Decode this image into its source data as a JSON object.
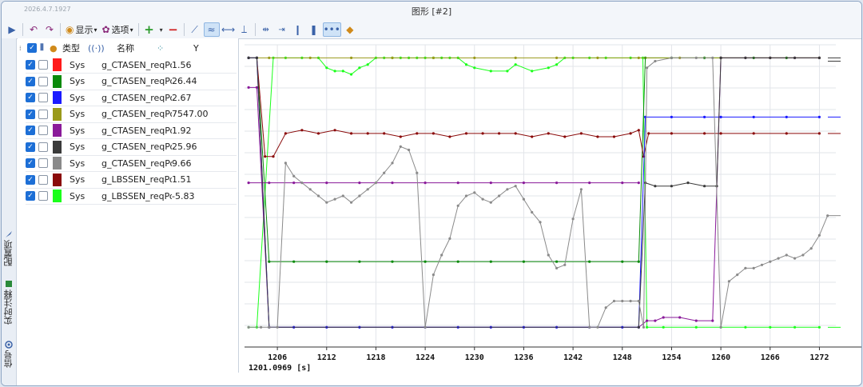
{
  "window": {
    "version_text": "2026.4.7.1927",
    "title": "图形 [#2]"
  },
  "toolbar": {
    "display_label": "显示",
    "options_label": "选项"
  },
  "side_tabs": [
    {
      "label": "配置项",
      "icon": "settings-icon"
    },
    {
      "label": "实时注释",
      "icon": "annotation-icon"
    },
    {
      "label": "信号",
      "icon": "signal-icon"
    }
  ],
  "table": {
    "headers": {
      "type": "类型",
      "name": "名称",
      "y": "Y"
    },
    "rows": [
      {
        "color": "#ff1a1a",
        "type": "Sys",
        "name": "g_CTASEN_reqPorts_",
        "value": "1.56"
      },
      {
        "color": "#0a8a0a",
        "type": "Sys",
        "name": "g_CTASEN_reqPorts_",
        "value": "26.44"
      },
      {
        "color": "#1a1aff",
        "type": "Sys",
        "name": "g_CTASEN_reqPorts_",
        "value": "2.67"
      },
      {
        "color": "#9a9a1a",
        "type": "Sys",
        "name": "g_CTASEN_reqPorts_",
        "value": "7547.00"
      },
      {
        "color": "#8a1a9a",
        "type": "Sys",
        "name": "g_CTASEN_reqPorts_",
        "value": "1.92"
      },
      {
        "color": "#3a3a3a",
        "type": "Sys",
        "name": "g_CTASEN_reqPorts_",
        "value": "25.96"
      },
      {
        "color": "#8a8a8a",
        "type": "Sys",
        "name": "g_CTASEN_reqPorts_",
        "value": "9.66"
      },
      {
        "color": "#8a0a0a",
        "type": "Sys",
        "name": "g_LBSSEN_reqPorts_",
        "value": "1.51"
      },
      {
        "color": "#1aff1a",
        "type": "Sys",
        "name": "g_LBSSEN_reqPorts_",
        "value": "-5.83"
      }
    ]
  },
  "chart_data": {
    "type": "line",
    "x_cursor_label": "1201.0969 [s]",
    "xlim": [
      1202,
      1274
    ],
    "x_ticks": [
      "1206",
      "1212",
      "1218",
      "1224",
      "1230",
      "1236",
      "1242",
      "1248",
      "1254",
      "1260",
      "1266",
      "1272"
    ],
    "grid": true,
    "series": [
      {
        "color": "#1aff1a",
        "points": [
          [
            1202.5,
            0.06
          ],
          [
            1203.5,
            0.06
          ],
          [
            1205.5,
            0.88
          ],
          [
            1207,
            0.88
          ],
          [
            1209,
            0.88
          ],
          [
            1211,
            0.88
          ],
          [
            1212,
            0.85
          ],
          [
            1213,
            0.84
          ],
          [
            1214,
            0.84
          ],
          [
            1215,
            0.83
          ],
          [
            1216,
            0.85
          ],
          [
            1217,
            0.86
          ],
          [
            1218,
            0.88
          ],
          [
            1219,
            0.88
          ],
          [
            1220,
            0.88
          ],
          [
            1221,
            0.88
          ],
          [
            1222,
            0.88
          ],
          [
            1223,
            0.88
          ],
          [
            1224,
            0.88
          ],
          [
            1225,
            0.88
          ],
          [
            1226,
            0.88
          ],
          [
            1227,
            0.88
          ],
          [
            1228,
            0.88
          ],
          [
            1229,
            0.86
          ],
          [
            1230,
            0.85
          ],
          [
            1232,
            0.84
          ],
          [
            1234,
            0.84
          ],
          [
            1235,
            0.86
          ],
          [
            1237,
            0.84
          ],
          [
            1239,
            0.85
          ],
          [
            1240,
            0.86
          ],
          [
            1241,
            0.88
          ],
          [
            1242,
            0.88
          ],
          [
            1244,
            0.88
          ],
          [
            1246,
            0.88
          ],
          [
            1249,
            0.88
          ],
          [
            1250.5,
            0.88
          ],
          [
            1251,
            0.06
          ],
          [
            1253,
            0.06
          ],
          [
            1257,
            0.06
          ],
          [
            1260,
            0.06
          ],
          [
            1263,
            0.06
          ],
          [
            1266,
            0.06
          ],
          [
            1269,
            0.06
          ],
          [
            1272,
            0.06
          ]
        ]
      },
      {
        "color": "#0a8a0a",
        "points": [
          [
            1202.5,
            0.88
          ],
          [
            1203.5,
            0.88
          ],
          [
            1205,
            0.26
          ],
          [
            1208,
            0.26
          ],
          [
            1212,
            0.26
          ],
          [
            1216,
            0.26
          ],
          [
            1220,
            0.26
          ],
          [
            1224,
            0.26
          ],
          [
            1228,
            0.26
          ],
          [
            1232,
            0.26
          ],
          [
            1236,
            0.26
          ],
          [
            1240,
            0.26
          ],
          [
            1244,
            0.26
          ],
          [
            1248,
            0.26
          ],
          [
            1250,
            0.26
          ],
          [
            1250.8,
            0.88
          ],
          [
            1254,
            0.88
          ],
          [
            1258,
            0.88
          ],
          [
            1260,
            0.88
          ],
          [
            1264,
            0.88
          ],
          [
            1268,
            0.88
          ],
          [
            1272,
            0.88
          ]
        ]
      },
      {
        "color": "#9a9a1a",
        "points": [
          [
            1202.5,
            0.88
          ],
          [
            1203.5,
            0.88
          ],
          [
            1205,
            0.88
          ],
          [
            1210,
            0.88
          ],
          [
            1215,
            0.88
          ],
          [
            1220,
            0.88
          ],
          [
            1225,
            0.88
          ],
          [
            1230,
            0.88
          ],
          [
            1235,
            0.88
          ],
          [
            1240,
            0.88
          ],
          [
            1245,
            0.88
          ],
          [
            1250,
            0.88
          ],
          [
            1255,
            0.88
          ],
          [
            1260,
            0.88
          ],
          [
            1266,
            0.88
          ],
          [
            1272,
            0.88
          ]
        ]
      },
      {
        "color": "#8a0a0a",
        "points": [
          [
            1202.5,
            0.88
          ],
          [
            1203.5,
            0.88
          ],
          [
            1204.5,
            0.58
          ],
          [
            1205.5,
            0.58
          ],
          [
            1207,
            0.65
          ],
          [
            1209,
            0.66
          ],
          [
            1211,
            0.65
          ],
          [
            1213,
            0.66
          ],
          [
            1215,
            0.65
          ],
          [
            1217,
            0.65
          ],
          [
            1219,
            0.65
          ],
          [
            1221,
            0.64
          ],
          [
            1223,
            0.65
          ],
          [
            1225,
            0.65
          ],
          [
            1227,
            0.64
          ],
          [
            1229,
            0.65
          ],
          [
            1231,
            0.65
          ],
          [
            1233,
            0.65
          ],
          [
            1235,
            0.65
          ],
          [
            1237,
            0.64
          ],
          [
            1239,
            0.65
          ],
          [
            1241,
            0.64
          ],
          [
            1243,
            0.65
          ],
          [
            1245,
            0.64
          ],
          [
            1247,
            0.64
          ],
          [
            1249,
            0.65
          ],
          [
            1250,
            0.66
          ],
          [
            1250.6,
            0.58
          ],
          [
            1251.2,
            0.65
          ],
          [
            1254,
            0.65
          ],
          [
            1258,
            0.65
          ],
          [
            1260,
            0.65
          ],
          [
            1264,
            0.65
          ],
          [
            1268,
            0.65
          ],
          [
            1272,
            0.65
          ]
        ]
      },
      {
        "color": "#8a1a9a",
        "points": [
          [
            1202.5,
            0.79
          ],
          [
            1203.5,
            0.79
          ],
          [
            1205,
            0.06
          ],
          [
            1208,
            0.06
          ],
          [
            1212,
            0.06
          ],
          [
            1216,
            0.06
          ],
          [
            1220,
            0.06
          ],
          [
            1224,
            0.06
          ],
          [
            1228,
            0.06
          ],
          [
            1232,
            0.06
          ],
          [
            1236,
            0.06
          ],
          [
            1240,
            0.06
          ],
          [
            1244,
            0.06
          ],
          [
            1248,
            0.06
          ],
          [
            1250,
            0.06
          ],
          [
            1251,
            0.08
          ],
          [
            1252,
            0.08
          ],
          [
            1253,
            0.09
          ],
          [
            1255,
            0.09
          ],
          [
            1257,
            0.08
          ],
          [
            1259,
            0.08
          ],
          [
            1260,
            0.88
          ],
          [
            1263,
            0.88
          ],
          [
            1266,
            0.88
          ],
          [
            1269,
            0.88
          ],
          [
            1272,
            0.88
          ]
        ]
      },
      {
        "color": "#8a1a9a",
        "points": [
          [
            1202.5,
            0.5
          ],
          [
            1205,
            0.5
          ],
          [
            1208,
            0.5
          ],
          [
            1212,
            0.5
          ],
          [
            1216,
            0.5
          ],
          [
            1220,
            0.5
          ],
          [
            1224,
            0.5
          ],
          [
            1228,
            0.5
          ],
          [
            1232,
            0.5
          ],
          [
            1236,
            0.5
          ],
          [
            1240,
            0.5
          ],
          [
            1244,
            0.5
          ],
          [
            1248,
            0.5
          ],
          [
            1250,
            0.5
          ]
        ]
      },
      {
        "color": "#1a1aff",
        "points": [
          [
            1202.5,
            0.88
          ],
          [
            1203.5,
            0.88
          ],
          [
            1205,
            0.06
          ],
          [
            1208,
            0.06
          ],
          [
            1212,
            0.06
          ],
          [
            1216,
            0.06
          ],
          [
            1220,
            0.06
          ],
          [
            1224,
            0.06
          ],
          [
            1228,
            0.06
          ],
          [
            1232,
            0.06
          ],
          [
            1236,
            0.06
          ],
          [
            1240,
            0.06
          ],
          [
            1244,
            0.06
          ],
          [
            1248,
            0.06
          ],
          [
            1250,
            0.06
          ],
          [
            1250.8,
            0.7
          ],
          [
            1254,
            0.7
          ],
          [
            1258,
            0.7
          ],
          [
            1260,
            0.7
          ],
          [
            1264,
            0.7
          ],
          [
            1268,
            0.7
          ],
          [
            1272,
            0.7
          ]
        ]
      },
      {
        "color": "#3a3a3a",
        "points": [
          [
            1202.5,
            0.88
          ],
          [
            1203.5,
            0.88
          ],
          [
            1205,
            0.06
          ],
          [
            1250,
            0.06
          ],
          [
            1250.8,
            0.5
          ],
          [
            1252,
            0.49
          ],
          [
            1254,
            0.49
          ],
          [
            1256,
            0.5
          ],
          [
            1258,
            0.49
          ],
          [
            1259.5,
            0.49
          ],
          [
            1260,
            0.88
          ],
          [
            1263,
            0.88
          ],
          [
            1266,
            0.88
          ],
          [
            1269,
            0.88
          ],
          [
            1272,
            0.88
          ]
        ]
      },
      {
        "color": "#8a8a8a",
        "points": [
          [
            1202.5,
            0.06
          ],
          [
            1204,
            0.06
          ],
          [
            1205,
            0.06
          ],
          [
            1206,
            0.06
          ],
          [
            1207,
            0.56
          ],
          [
            1208,
            0.52
          ],
          [
            1209,
            0.5
          ],
          [
            1210,
            0.48
          ],
          [
            1211,
            0.46
          ],
          [
            1212,
            0.44
          ],
          [
            1213,
            0.45
          ],
          [
            1214,
            0.46
          ],
          [
            1215,
            0.44
          ],
          [
            1216,
            0.46
          ],
          [
            1217,
            0.48
          ],
          [
            1218,
            0.5
          ],
          [
            1219,
            0.53
          ],
          [
            1220,
            0.56
          ],
          [
            1221,
            0.61
          ],
          [
            1222,
            0.6
          ],
          [
            1223,
            0.53
          ],
          [
            1224,
            0.06
          ],
          [
            1225,
            0.22
          ],
          [
            1226,
            0.28
          ],
          [
            1227,
            0.33
          ],
          [
            1228,
            0.43
          ],
          [
            1229,
            0.46
          ],
          [
            1230,
            0.47
          ],
          [
            1231,
            0.45
          ],
          [
            1232,
            0.44
          ],
          [
            1233,
            0.46
          ],
          [
            1234,
            0.48
          ],
          [
            1235,
            0.49
          ],
          [
            1236,
            0.45
          ],
          [
            1237,
            0.41
          ],
          [
            1238,
            0.38
          ],
          [
            1239,
            0.28
          ],
          [
            1240,
            0.24
          ],
          [
            1241,
            0.25
          ],
          [
            1242,
            0.39
          ],
          [
            1243,
            0.48
          ],
          [
            1244,
            0.06
          ],
          [
            1245,
            0.06
          ],
          [
            1246,
            0.12
          ],
          [
            1247,
            0.14
          ],
          [
            1248,
            0.14
          ],
          [
            1249,
            0.14
          ],
          [
            1250,
            0.14
          ],
          [
            1250.6,
            0.06
          ],
          [
            1251,
            0.85
          ],
          [
            1252,
            0.87
          ],
          [
            1254,
            0.88
          ],
          [
            1257,
            0.88
          ],
          [
            1259,
            0.88
          ],
          [
            1260,
            0.06
          ],
          [
            1261,
            0.2
          ],
          [
            1262,
            0.22
          ],
          [
            1263,
            0.24
          ],
          [
            1264,
            0.24
          ],
          [
            1265,
            0.25
          ],
          [
            1266,
            0.26
          ],
          [
            1267,
            0.27
          ],
          [
            1268,
            0.28
          ],
          [
            1269,
            0.27
          ],
          [
            1270,
            0.28
          ],
          [
            1271,
            0.3
          ],
          [
            1272,
            0.34
          ],
          [
            1273,
            0.4
          ]
        ]
      }
    ],
    "tail_marks": [
      {
        "color": "#3a3a3a",
        "y": 0.88
      },
      {
        "color": "#3a3a3a",
        "y": 0.87
      },
      {
        "color": "#1a1aff",
        "y": 0.7
      },
      {
        "color": "#8a0a0a",
        "y": 0.65
      },
      {
        "color": "#8a8a8a",
        "y": 0.4
      },
      {
        "color": "#1aff1a",
        "y": 0.06
      }
    ]
  }
}
